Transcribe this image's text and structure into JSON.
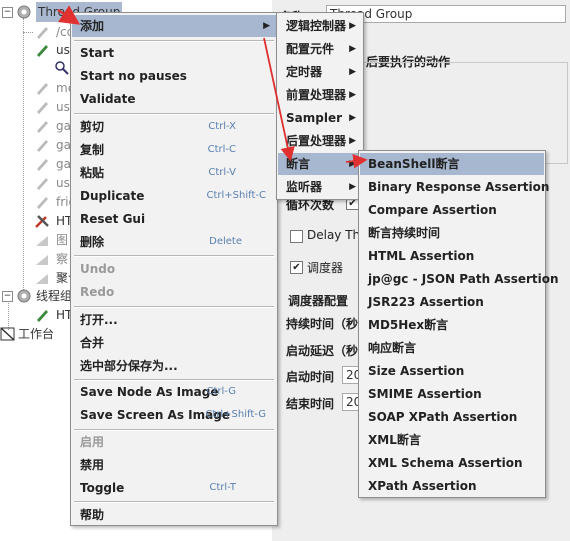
{
  "tree": {
    "nodes": [
      {
        "label": "Thread Group",
        "selected": true
      },
      {
        "label": "/cc"
      },
      {
        "label": "us"
      },
      {
        "label": ""
      },
      {
        "label": "me"
      },
      {
        "label": "us"
      },
      {
        "label": "ga"
      },
      {
        "label": "ga"
      },
      {
        "label": "ga"
      },
      {
        "label": "us"
      },
      {
        "label": "frie"
      },
      {
        "label": "HT"
      },
      {
        "label": "图"
      },
      {
        "label": "察"
      },
      {
        "label": "聚合"
      },
      {
        "label": "线程组"
      },
      {
        "label": "HT"
      },
      {
        "label": "工作台"
      }
    ]
  },
  "right_panel": {
    "name_label": "名称：",
    "name_value": "Thread Group",
    "after_error_label": "后要执行的动作",
    "loop_label": "循环次数",
    "delay_label": "Delay Thr",
    "scheduler_label": "调度器",
    "scheduler_config_label": "调度器配置",
    "duration_label": "持续时间（秒",
    "startup_delay_label": "启动延迟（秒",
    "start_time_label": "启动时间",
    "start_time_value": "20",
    "end_time_label": "结束时间",
    "end_time_value": "20"
  },
  "context_menu": {
    "items": [
      {
        "label": "添加",
        "submenu": true
      },
      {
        "label": "Start"
      },
      {
        "label": "Start no pauses"
      },
      {
        "label": "Validate"
      },
      {
        "label": "剪切",
        "shortcut": "Ctrl-X"
      },
      {
        "label": "复制",
        "shortcut": "Ctrl-C"
      },
      {
        "label": "粘贴",
        "shortcut": "Ctrl-V"
      },
      {
        "label": "Duplicate",
        "shortcut": "Ctrl+Shift-C"
      },
      {
        "label": "Reset Gui"
      },
      {
        "label": "删除",
        "shortcut": "Delete"
      },
      {
        "label": "Undo",
        "disabled": true
      },
      {
        "label": "Redo",
        "disabled": true
      },
      {
        "label": "打开..."
      },
      {
        "label": "合并"
      },
      {
        "label": "选中部分保存为..."
      },
      {
        "label": "Save Node As Image",
        "shortcut": "Ctrl-G"
      },
      {
        "label": "Save Screen As Image",
        "shortcut": "Ctrl+Shift-G"
      },
      {
        "label": "启用",
        "disabled": true
      },
      {
        "label": "禁用"
      },
      {
        "label": "Toggle",
        "shortcut": "Ctrl-T"
      },
      {
        "label": "帮助"
      }
    ]
  },
  "add_submenu": {
    "items": [
      {
        "label": "逻辑控制器"
      },
      {
        "label": "配置元件"
      },
      {
        "label": "定时器"
      },
      {
        "label": "前置处理器"
      },
      {
        "label": "Sampler"
      },
      {
        "label": "后置处理器"
      },
      {
        "label": "断言"
      },
      {
        "label": "监听器"
      }
    ]
  },
  "assertion_submenu": {
    "items": [
      {
        "label": "BeanShell断言"
      },
      {
        "label": "Binary Response Assertion"
      },
      {
        "label": "Compare Assertion"
      },
      {
        "label": "断言持续时间"
      },
      {
        "label": "HTML Assertion"
      },
      {
        "label": "jp@gc - JSON Path Assertion"
      },
      {
        "label": "JSR223 Assertion"
      },
      {
        "label": "MD5Hex断言"
      },
      {
        "label": "响应断言"
      },
      {
        "label": "Size Assertion"
      },
      {
        "label": "SMIME Assertion"
      },
      {
        "label": "SOAP XPath Assertion"
      },
      {
        "label": "XML断言"
      },
      {
        "label": "XML Schema Assertion"
      },
      {
        "label": "XPath Assertion"
      }
    ]
  },
  "colors": {
    "highlight": "#a7b7cf",
    "annotation": "#e03030",
    "shortcut": "#5a7fb0"
  }
}
